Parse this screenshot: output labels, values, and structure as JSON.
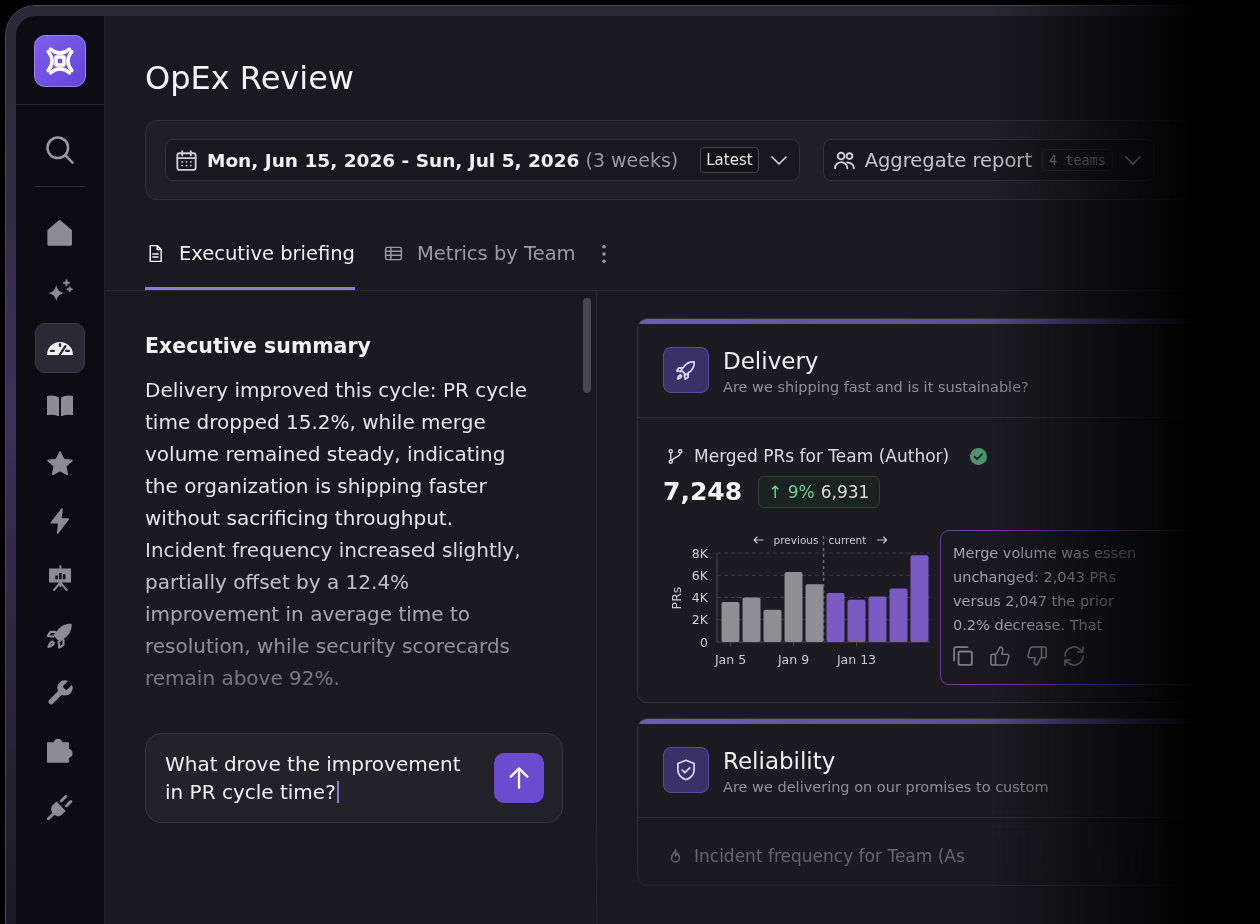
{
  "sidebar": {
    "items": [
      {
        "kind": "home",
        "selected": false
      },
      {
        "kind": "sparkles",
        "selected": false
      },
      {
        "kind": "gauge",
        "selected": true
      },
      {
        "kind": "book",
        "selected": false
      },
      {
        "kind": "star",
        "selected": false
      },
      {
        "kind": "bolt",
        "selected": false
      },
      {
        "kind": "presentation",
        "selected": false
      },
      {
        "kind": "rocket",
        "selected": false
      },
      {
        "kind": "wrench",
        "selected": false
      },
      {
        "kind": "puzzle",
        "selected": false
      },
      {
        "kind": "plug",
        "selected": false
      }
    ]
  },
  "page": {
    "title": "OpEx Review"
  },
  "filters": {
    "date_range": {
      "range": "Mon, Jun 15, 2026 - Sun, Jul 5, 2026",
      "duration": "(3 weeks)",
      "preset": "Latest"
    },
    "report": {
      "label": "Aggregate report",
      "teams": "4 teams"
    }
  },
  "tabs": [
    {
      "kind": "document",
      "label": "Executive briefing",
      "selected": true
    },
    {
      "kind": "table",
      "label": "Metrics by Team",
      "selected": false
    }
  ],
  "summary": {
    "heading": "Executive summary",
    "text": "Delivery improved this cycle: PR cycle time dropped 15.2%, while merge volume remained steady, indicating the organization is shipping faster without sacrificing throughput. Incident frequency increased slightly, partially offset by a 12.4% improvement in average time to resolution, while security scorecards remain above 92%."
  },
  "chat": {
    "value": "What drove the improvement in PR cycle time?"
  },
  "sections": [
    {
      "kind": "rocket",
      "title": "Delivery",
      "subtitle": "Are we shipping fast and is it sustainable?",
      "metric": {
        "kind": "branch",
        "title": "Merged PRs for Team (Author)",
        "verified": true,
        "value": "7,248",
        "change": "↑ 9%",
        "previous": "6,931",
        "chart_data": {
          "type": "bar",
          "ylabel": "PRs",
          "categories": [
            "Jan 5",
            null,
            null,
            "Jan 9",
            null,
            null,
            "Jan 13",
            null,
            null,
            null
          ],
          "series": [
            {
              "name": "previous",
              "color": "#8e8e93",
              "values": [
                3600,
                4000,
                2900,
                6300,
                5200,
                null,
                null,
                null,
                null,
                null
              ]
            },
            {
              "name": "current",
              "color": "#7a5bc4",
              "values": [
                null,
                null,
                null,
                null,
                null,
                4400,
                3800,
                4100,
                4800,
                7800
              ]
            }
          ],
          "stacked": true,
          "grid": true,
          "ylim": [
            0,
            8000
          ],
          "yticks": [
            0,
            {
              "value": 2000,
              "label": "2K"
            },
            {
              "value": 4000,
              "label": "4K"
            },
            {
              "value": 6000,
              "label": "6K"
            },
            {
              "value": 8000,
              "label": "8K"
            }
          ]
        },
        "insight": {
          "lines": [
            "Merge volume was essen",
            "unchanged: 2,043 PRs",
            "versus 2,047 the prior",
            "0.2% decrease. That"
          ]
        }
      }
    },
    {
      "kind": "shield",
      "title": "Reliability",
      "subtitle": "Are we delivering on our promises to custom",
      "metric": {
        "kind": "flame",
        "title": "Incident frequency for Team (As"
      }
    }
  ]
}
